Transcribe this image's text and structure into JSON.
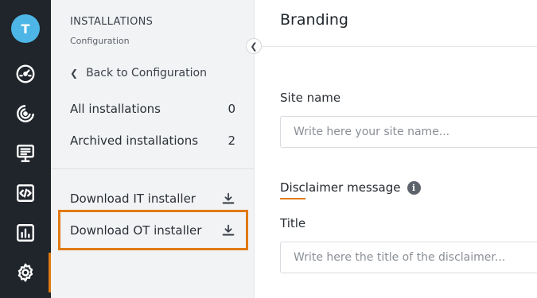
{
  "rail": {
    "avatar_initial": "T",
    "items": [
      {
        "icon": "speedometer-icon"
      },
      {
        "icon": "radar-icon"
      },
      {
        "icon": "monitor-icon"
      },
      {
        "icon": "code-file-icon"
      },
      {
        "icon": "bar-chart-icon"
      },
      {
        "icon": "gear-icon",
        "active": true
      }
    ]
  },
  "subnav": {
    "title": "INSTALLATIONS",
    "subtitle": "Configuration",
    "back_label": "Back to Configuration",
    "items": [
      {
        "label": "All installations",
        "count": "0"
      },
      {
        "label": "Archived installations",
        "count": "2"
      }
    ],
    "downloads": [
      {
        "label": "Download IT installer",
        "icon": "download-icon"
      },
      {
        "label": "Download OT installer",
        "icon": "download-icon"
      }
    ]
  },
  "main": {
    "title": "Branding",
    "site_name": {
      "label": "Site name",
      "placeholder": "Write here your site name..."
    },
    "disclaimer": {
      "section_title": "Disclaimer message",
      "title_label": "Title",
      "title_placeholder": "Write here the title of the disclaimer..."
    }
  },
  "colors": {
    "accent": "#e07b13",
    "rail_bg": "#1f252b",
    "avatar_bg": "#4db6e6"
  }
}
